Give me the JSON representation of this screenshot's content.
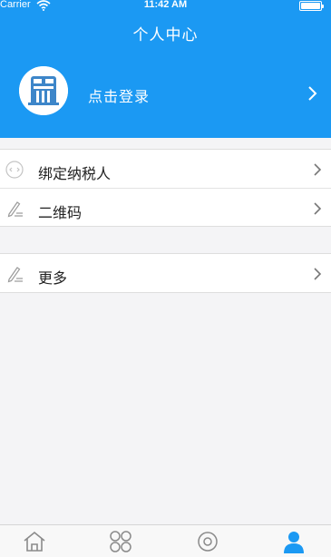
{
  "status_bar": {
    "carrier": "Carrier",
    "time": "11:42 AM"
  },
  "nav": {
    "title": "个人中心"
  },
  "login": {
    "text": "点击登录"
  },
  "menu": {
    "group1": [
      {
        "label": "绑定纳税人",
        "icon": "link-icon"
      },
      {
        "label": "二维码",
        "icon": "pen-icon"
      }
    ],
    "group2": [
      {
        "label": "更多",
        "icon": "pen-icon"
      }
    ]
  },
  "tabbar": {
    "tabs": [
      {
        "icon": "home-icon"
      },
      {
        "icon": "apps-grid-icon"
      },
      {
        "icon": "service-icon"
      },
      {
        "icon": "user-icon",
        "active": true
      }
    ]
  },
  "colors": {
    "primary": "#1b99f3",
    "background": "#f4f4f6",
    "text": "#222222"
  }
}
